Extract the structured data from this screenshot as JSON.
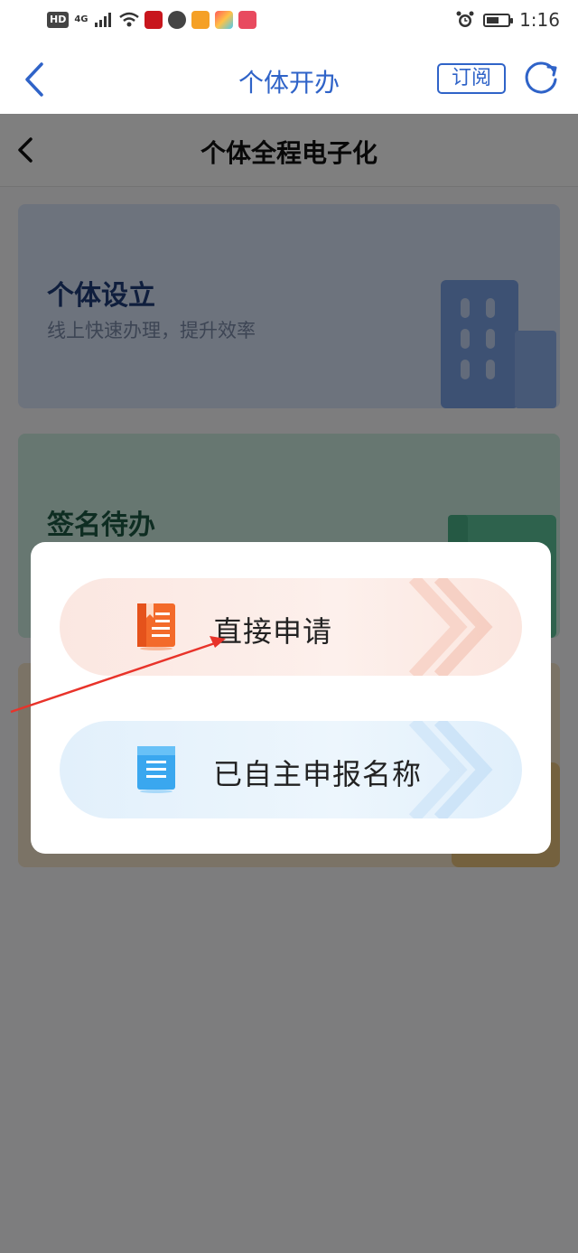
{
  "status_bar": {
    "network_badge": "HD",
    "network_type": "4G",
    "time": "1:16",
    "battery_level": 0.6,
    "icons": [
      "hd-icon",
      "signal-icon",
      "wifi-icon",
      "app-icon-red",
      "app-icon-ball",
      "app-icon-play",
      "app-icon-grid",
      "app-icon-book",
      "alarm-icon",
      "battery-icon"
    ]
  },
  "app_bar": {
    "title": "个体开办",
    "subscribe_label": "订阅",
    "accent": "#2f63c8"
  },
  "page": {
    "title": "个体全程电子化",
    "cards": [
      {
        "title": "个体设立",
        "subtitle": "线上快速办理，提升效率",
        "color": "#dbe6fb",
        "title_color": "#1f3d7a"
      },
      {
        "title": "签名待办",
        "subtitle": "",
        "color": "#cfeee2",
        "title_color": "#1d5a45"
      },
      {
        "title": "",
        "subtitle": "",
        "color": "#f7e7cc",
        "title_color": "#7a5a1d"
      }
    ]
  },
  "modal": {
    "options": [
      {
        "label": "直接申请",
        "icon": "document-orange-icon",
        "color": "#f36a2a"
      },
      {
        "label": "已自主申报名称",
        "icon": "document-blue-icon",
        "color": "#3aa7ef"
      }
    ]
  },
  "annotation": {
    "arrow_color": "#e8332a"
  }
}
